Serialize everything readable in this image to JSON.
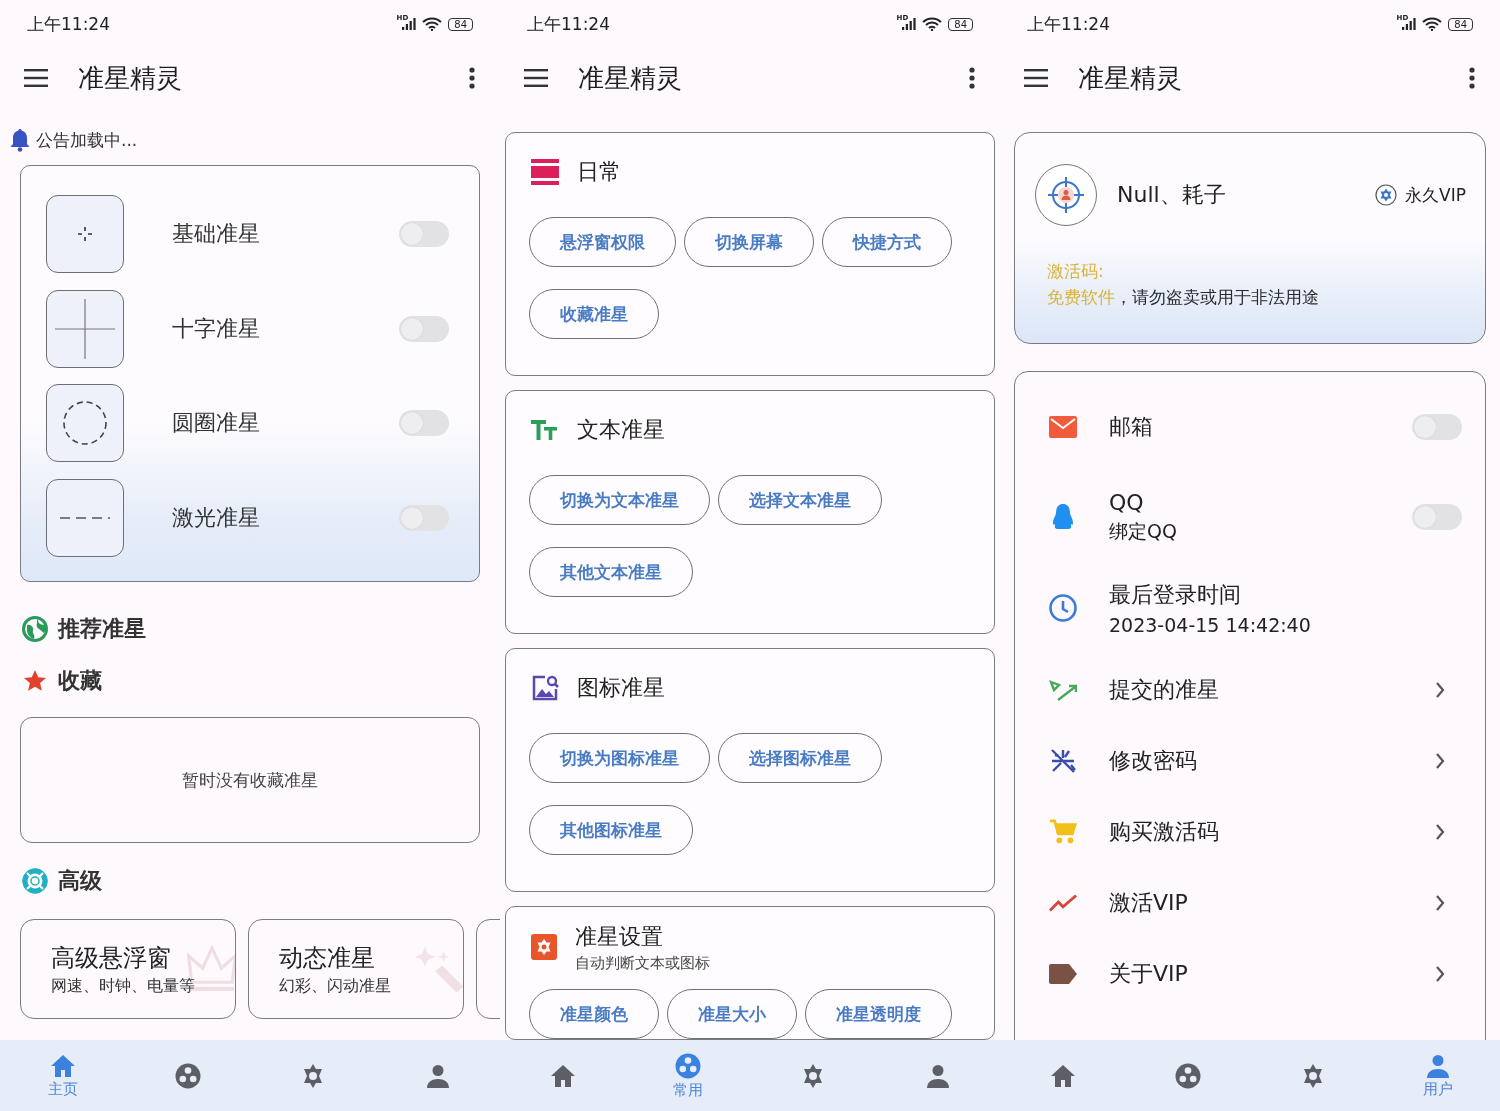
{
  "screens": [
    {
      "kind": "home",
      "status_bar": {
        "time": "上午11:24",
        "network": "HD",
        "battery": "84"
      },
      "app_bar": {
        "title": "准星精灵"
      },
      "notice": "公告加载中...",
      "crosshairs": [
        {
          "label": "基础准星",
          "on": false
        },
        {
          "label": "十字准星",
          "on": false
        },
        {
          "label": "圆圈准星",
          "on": false
        },
        {
          "label": "激光准星",
          "on": false
        }
      ],
      "recommended": {
        "title": "推荐准星"
      },
      "favorites": {
        "title": "收藏",
        "empty_text": "暂时没有收藏准星"
      },
      "advanced": {
        "title": "高级",
        "has_more": true,
        "cards": [
          {
            "title": "高级悬浮窗",
            "subtitle": "网速、时钟、电量等"
          },
          {
            "title": "动态准星",
            "subtitle": "幻彩、闪动准星"
          }
        ]
      },
      "nav": [
        {
          "label": "主页",
          "selected": true
        },
        {
          "selected": false
        },
        {
          "selected": false
        },
        {
          "selected": false
        }
      ]
    },
    {
      "kind": "common",
      "status_bar": {
        "time": "上午11:24",
        "network": "HD",
        "battery": "84"
      },
      "app_bar": {
        "title": "准星精灵"
      },
      "groups": [
        {
          "title": "日常",
          "buttons": [
            "悬浮窗权限",
            "切换屏幕",
            "快捷方式",
            "收藏准星"
          ]
        },
        {
          "title": "文本准星",
          "buttons": [
            "切换为文本准星",
            "选择文本准星",
            "其他文本准星"
          ]
        },
        {
          "title": "图标准星",
          "buttons": [
            "切换为图标准星",
            "选择图标准星",
            "其他图标准星"
          ]
        },
        {
          "title": "准星设置",
          "subtitle": "自动判断文本或图标",
          "buttons": [
            "准星颜色",
            "准星大小",
            "准星透明度"
          ]
        }
      ],
      "nav": [
        {
          "selected": false
        },
        {
          "label": "常用",
          "selected": true
        },
        {
          "selected": false
        },
        {
          "selected": false
        }
      ]
    },
    {
      "kind": "user",
      "status_bar": {
        "time": "上午11:24",
        "network": "HD",
        "battery": "84"
      },
      "app_bar": {
        "title": "准星精灵"
      },
      "profile": {
        "name": "Null、耗子",
        "badge": "永久VIP",
        "code_label": "激活码:",
        "notice_lead": "免费软件",
        "notice_rest": "，请勿盗卖或用于非法用途"
      },
      "items": [
        {
          "kind": "switch",
          "title": "邮箱",
          "on": false
        },
        {
          "kind": "switch",
          "title": "QQ",
          "subtitle": "绑定QQ",
          "on": false
        },
        {
          "kind": "info",
          "title": "最后登录时间",
          "subtitle": "2023-04-15 14:42:40"
        },
        {
          "kind": "link",
          "title": "提交的准星"
        },
        {
          "kind": "link",
          "title": "修改密码"
        },
        {
          "kind": "link",
          "title": "购买激活码"
        },
        {
          "kind": "link",
          "title": "激活VIP"
        },
        {
          "kind": "link",
          "title": "关于VIP"
        }
      ],
      "nav": [
        {
          "selected": false
        },
        {
          "selected": false
        },
        {
          "selected": false
        },
        {
          "label": "用户",
          "selected": true
        }
      ]
    }
  ]
}
